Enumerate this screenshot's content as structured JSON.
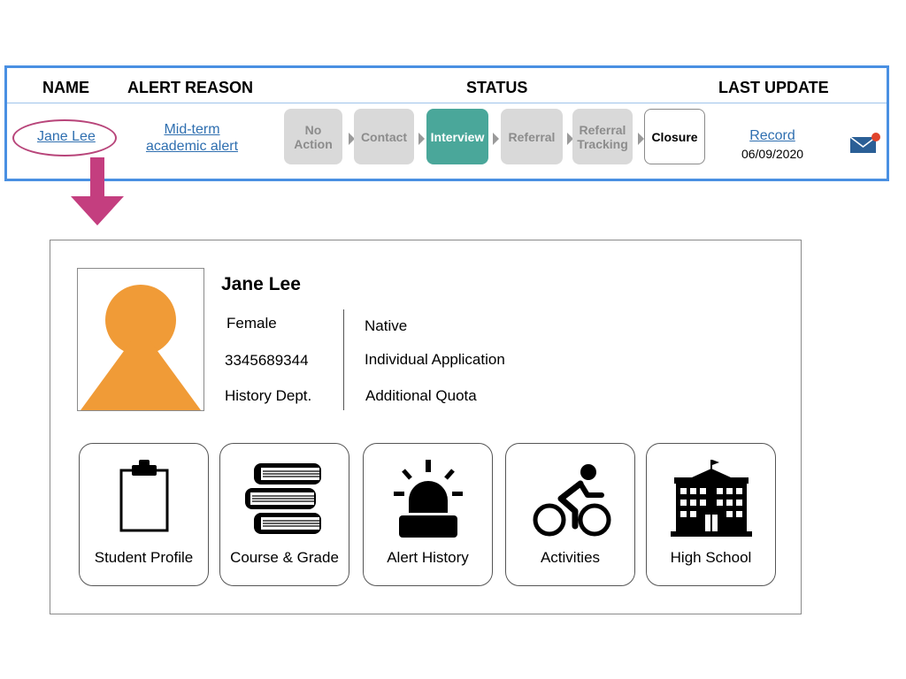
{
  "table": {
    "headers": {
      "name": "NAME",
      "reason": "ALERT REASON",
      "status": "STATUS",
      "update": "LAST UPDATE"
    },
    "row": {
      "name": "Jane Lee",
      "reason_line1": "Mid-term",
      "reason_line2": "academic alert",
      "steps": [
        {
          "line1": "No",
          "line2": "Action",
          "state": "inactive"
        },
        {
          "line1": "Contact",
          "line2": "",
          "state": "inactive"
        },
        {
          "line1": "Interview",
          "line2": "",
          "state": "active"
        },
        {
          "line1": "Referral",
          "line2": "",
          "state": "inactive"
        },
        {
          "line1": "Referral",
          "line2": "Tracking",
          "state": "inactive"
        },
        {
          "line1": "Closure",
          "line2": "",
          "state": "outlined"
        }
      ],
      "record_label": "Record",
      "record_date": "06/09/2020",
      "mail_icon": "mail-icon",
      "mail_notification_color": "#e0442c"
    }
  },
  "profile": {
    "name": "Jane Lee",
    "gender": "Female",
    "id": "3345689344",
    "department": "History Dept.",
    "origin": "Native",
    "application": "Individual Application",
    "quota": "Additional Quota",
    "avatar_color": "#f09b37"
  },
  "cards": [
    {
      "label": "Student Profile",
      "icon": "clipboard-icon"
    },
    {
      "label": "Course & Grade",
      "icon": "books-icon"
    },
    {
      "label": "Alert History",
      "icon": "siren-icon"
    },
    {
      "label": "Activities",
      "icon": "cyclist-icon"
    },
    {
      "label": "High School",
      "icon": "school-building-icon"
    }
  ],
  "colors": {
    "table_border": "#4a90e2",
    "active_step": "#4aa79a",
    "inactive_step": "#d9d9d9",
    "link": "#2f6fb0",
    "highlight": "#b8457a"
  }
}
